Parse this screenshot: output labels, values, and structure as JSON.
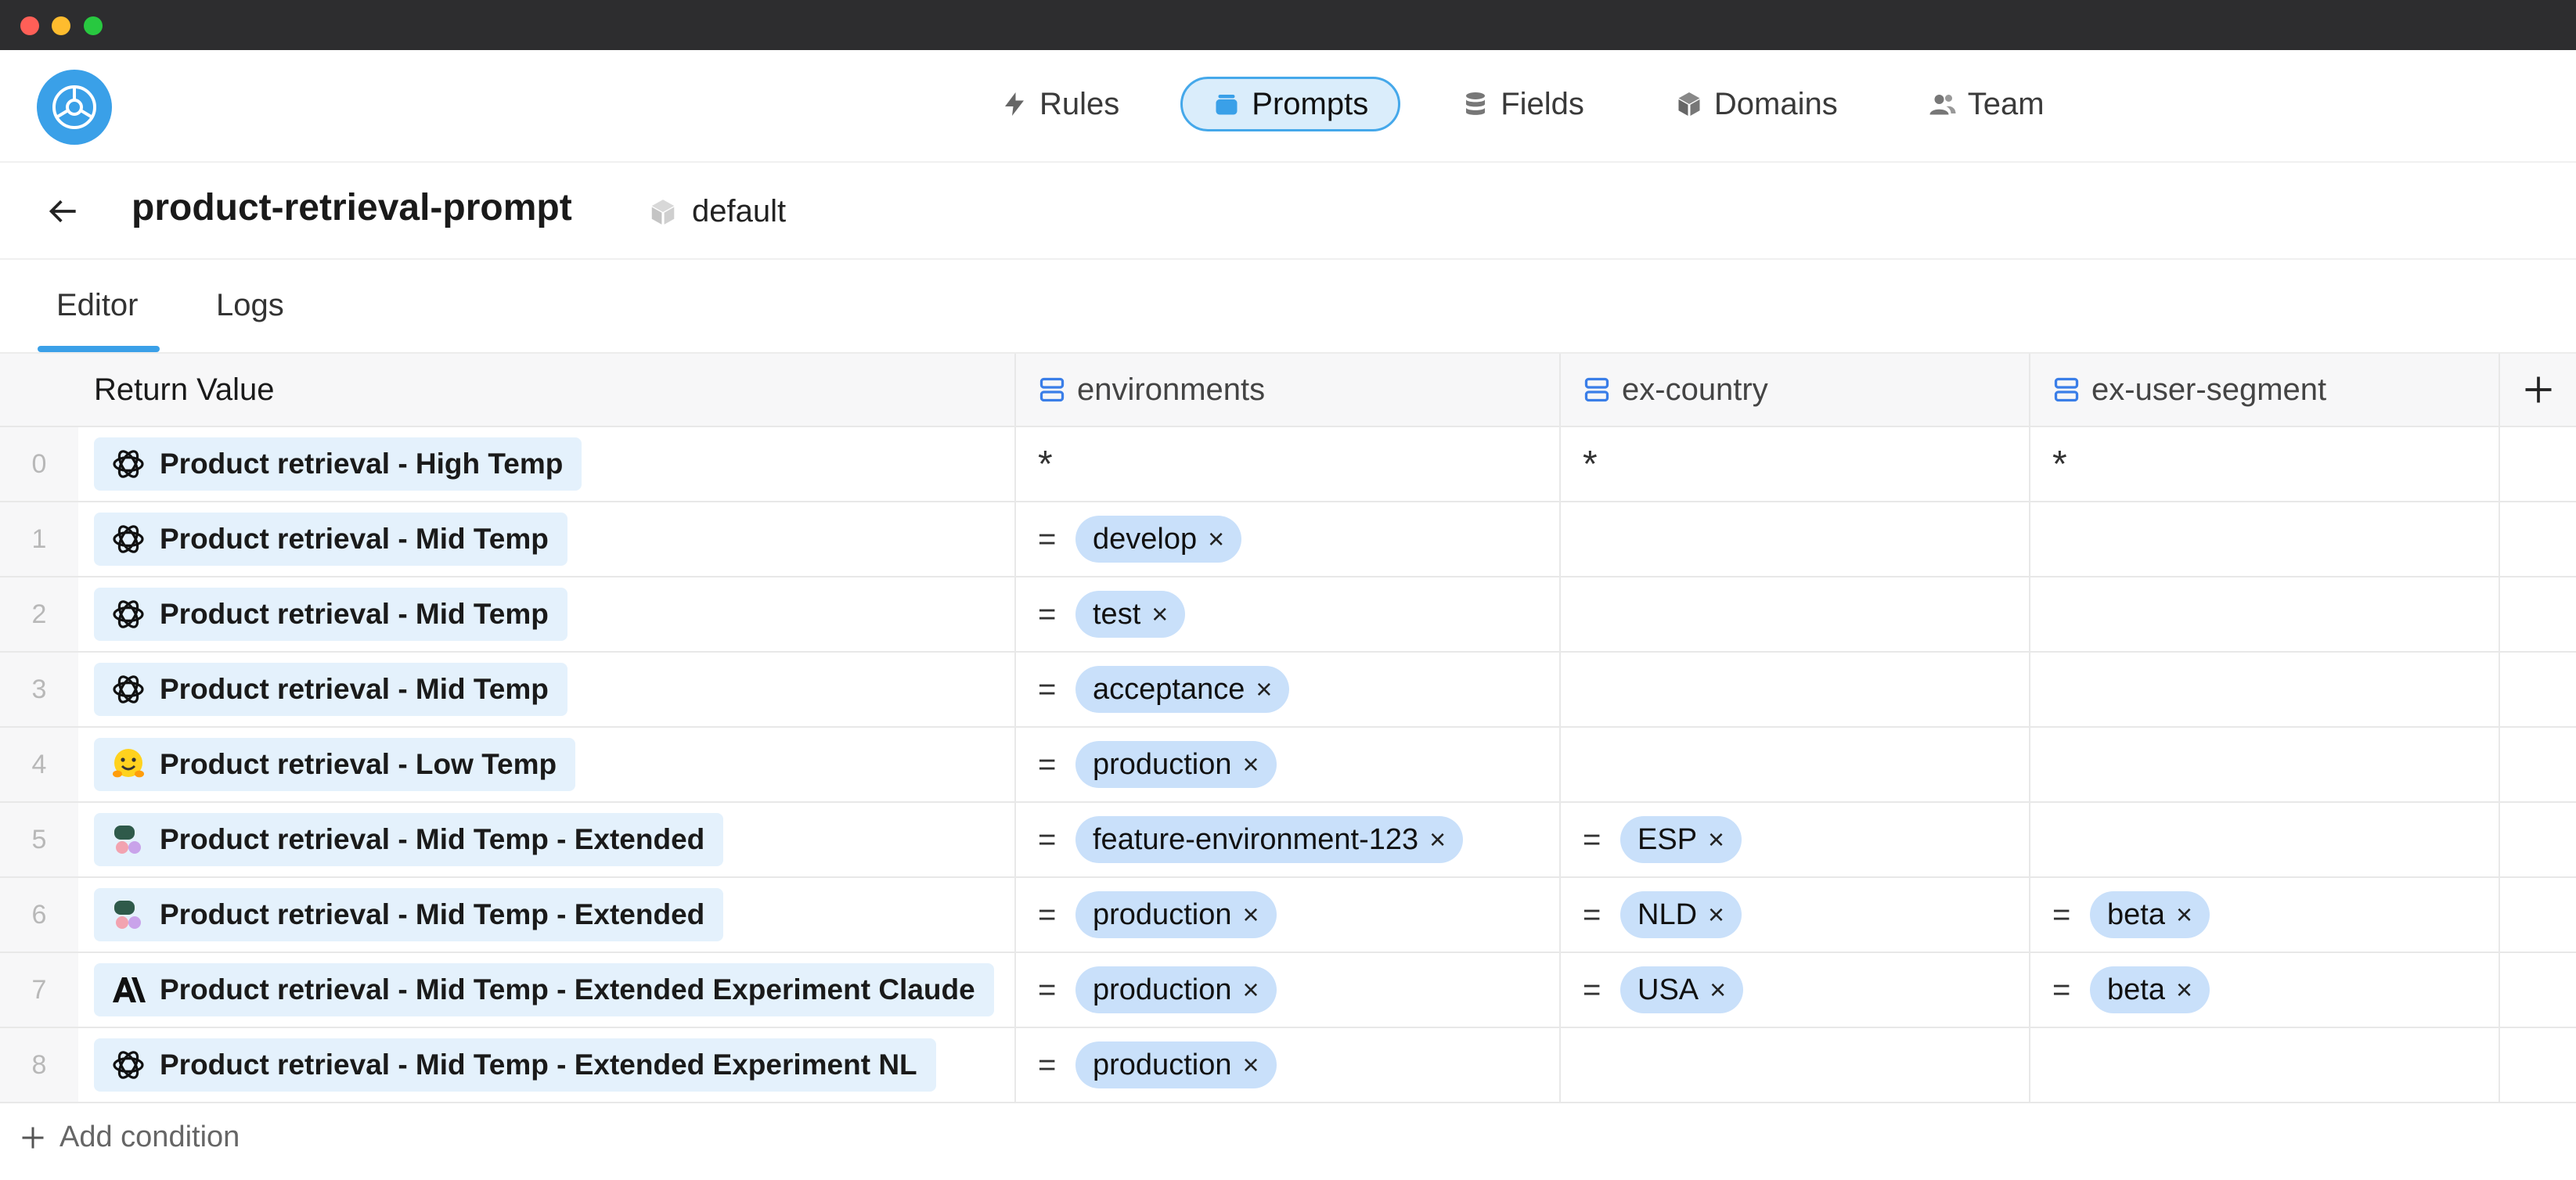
{
  "window": {
    "controls": [
      "close",
      "minimize",
      "maximize"
    ]
  },
  "nav": {
    "items": [
      {
        "label": "Rules",
        "icon": "bolt-icon",
        "active": false
      },
      {
        "label": "Prompts",
        "icon": "prompts-icon",
        "active": true
      },
      {
        "label": "Fields",
        "icon": "database-icon",
        "active": false
      },
      {
        "label": "Domains",
        "icon": "cube-icon",
        "active": false
      },
      {
        "label": "Team",
        "icon": "users-icon",
        "active": false
      }
    ]
  },
  "page": {
    "title": "product-retrieval-prompt",
    "domain": "default"
  },
  "tabs": {
    "editor": "Editor",
    "logs": "Logs",
    "active": "Editor"
  },
  "table": {
    "headers": {
      "return_value": "Return Value",
      "col1": "environments",
      "col2": "ex-country",
      "col3": "ex-user-segment"
    },
    "rows": [
      {
        "idx": "0",
        "icon": "openai-icon",
        "value": "Product retrieval - High Temp",
        "env_op": "*",
        "env": "",
        "country_op": "*",
        "country": "",
        "segment_op": "*",
        "segment": ""
      },
      {
        "idx": "1",
        "icon": "openai-icon",
        "value": "Product retrieval - Mid Temp",
        "env_op": "=",
        "env": "develop",
        "country_op": "",
        "country": "",
        "segment_op": "",
        "segment": ""
      },
      {
        "idx": "2",
        "icon": "openai-icon",
        "value": "Product retrieval - Mid Temp",
        "env_op": "=",
        "env": "test",
        "country_op": "",
        "country": "",
        "segment_op": "",
        "segment": ""
      },
      {
        "idx": "3",
        "icon": "openai-icon",
        "value": "Product retrieval - Mid Temp",
        "env_op": "=",
        "env": "acceptance",
        "country_op": "",
        "country": "",
        "segment_op": "",
        "segment": ""
      },
      {
        "idx": "4",
        "icon": "huggingface-icon",
        "value": "Product retrieval - Low Temp",
        "env_op": "=",
        "env": "production",
        "country_op": "",
        "country": "",
        "segment_op": "",
        "segment": ""
      },
      {
        "idx": "5",
        "icon": "mistral-icon",
        "value": "Product retrieval - Mid Temp - Extended",
        "env_op": "=",
        "env": "feature-environment-123",
        "country_op": "=",
        "country": "ESP",
        "segment_op": "",
        "segment": ""
      },
      {
        "idx": "6",
        "icon": "mistral-icon",
        "value": "Product retrieval - Mid Temp - Extended",
        "env_op": "=",
        "env": "production",
        "country_op": "=",
        "country": "NLD",
        "segment_op": "=",
        "segment": "beta"
      },
      {
        "idx": "7",
        "icon": "anthropic-icon",
        "value": "Product retrieval - Mid Temp - Extended Experiment Claude",
        "env_op": "=",
        "env": "production",
        "country_op": "=",
        "country": "USA",
        "segment_op": "=",
        "segment": "beta"
      },
      {
        "idx": "8",
        "icon": "openai-icon",
        "value": "Product retrieval - Mid Temp - Extended Experiment NL",
        "env_op": "=",
        "env": "production",
        "country_op": "",
        "country": "",
        "segment_op": "",
        "segment": ""
      }
    ],
    "chip_remove_glyph": "×",
    "add_condition": "Add condition"
  },
  "colors": {
    "accent": "#3aa0e8",
    "chip": "#c9e0fa",
    "return_value_bg": "#e4f1fc"
  }
}
